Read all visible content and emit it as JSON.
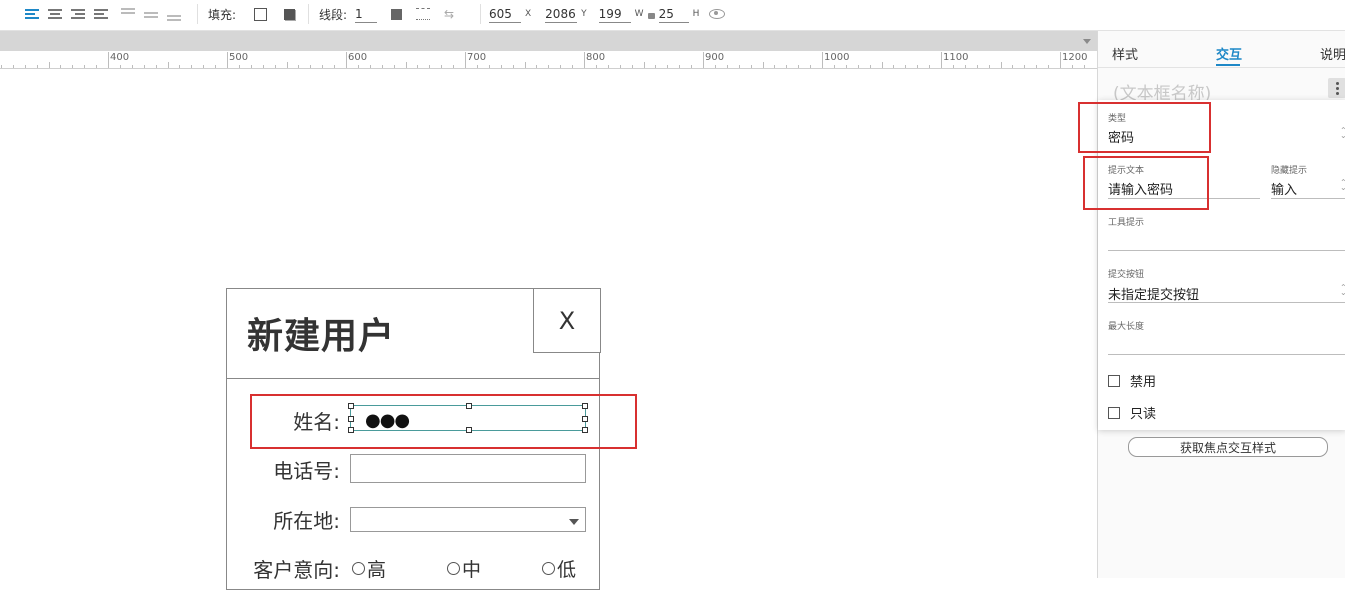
{
  "toolbar": {
    "fill_label": "填充:",
    "stroke_label": "线段:",
    "stroke_width": "1",
    "x_value": "605",
    "x_unit": "X",
    "y_value": "2086",
    "y_unit": "Y",
    "w_value": "199",
    "w_unit": "W",
    "h_value": "25",
    "h_unit": "H"
  },
  "ruler": {
    "labels": [
      "400",
      "500",
      "600",
      "700",
      "800",
      "900",
      "1000",
      "1100",
      "1200"
    ]
  },
  "dialog": {
    "title": "新建用户",
    "close": "X",
    "name_label": "姓名:",
    "name_value": "●●●",
    "phone_label": "电话号:",
    "location_label": "所在地:",
    "intent_label": "客户意向:",
    "intent_options": [
      "高",
      "中",
      "低"
    ]
  },
  "panel": {
    "tabs": [
      "样式",
      "交互",
      "说明"
    ],
    "active_tab": "交互",
    "widget_name_placeholder": "(文本框名称)",
    "type_label": "类型",
    "type_value": "密码",
    "hint_text_label": "提示文本",
    "hint_text_value": "请输入密码",
    "hide_hint_label": "隐藏提示",
    "hide_hint_value": "输入",
    "tooltip_label": "工具提示",
    "tooltip_value": "",
    "submit_label": "提交按钮",
    "submit_value": "未指定提交按钮",
    "maxlen_label": "最大长度",
    "maxlen_value": "",
    "disabled_label": "禁用",
    "readonly_label": "只读",
    "focus_style_button": "获取焦点交互样式"
  },
  "colors": {
    "accent": "#1e88c7",
    "highlight_red": "#d83030",
    "selection_teal": "#4a9b9b"
  }
}
